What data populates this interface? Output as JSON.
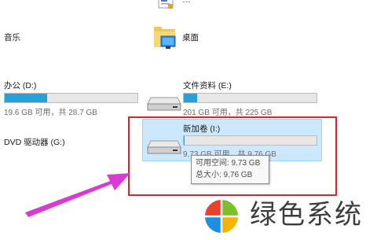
{
  "items": {
    "music": {
      "label": "音乐"
    },
    "desktop": {
      "label": "桌面"
    }
  },
  "drives": {
    "office": {
      "label": "办公 (D:)",
      "stats": "19.6 GB 可用，共 28.7 GB",
      "used_fraction": 0.32
    },
    "docs": {
      "label": "文件资料 (E:)",
      "stats": "201 GB 可用，共 225 GB",
      "used_fraction": 0.1
    },
    "dvd": {
      "label": "DVD 驱动器 (G:)"
    },
    "new_volume": {
      "label": "新加卷 (I:)",
      "stats": "9.73 GB 可用，共 9.76 GB",
      "used_fraction": 0.003
    }
  },
  "tooltip": {
    "free": "可用空间: 9.73 GB",
    "total": "总大小: 9.76 GB"
  },
  "brand": {
    "text": "绿色系统"
  },
  "colors": {
    "bar_fill": "#26a0da",
    "highlight": "#cce8ff",
    "annotation_red": "#e3212b",
    "arrow": "#d63bd6"
  }
}
